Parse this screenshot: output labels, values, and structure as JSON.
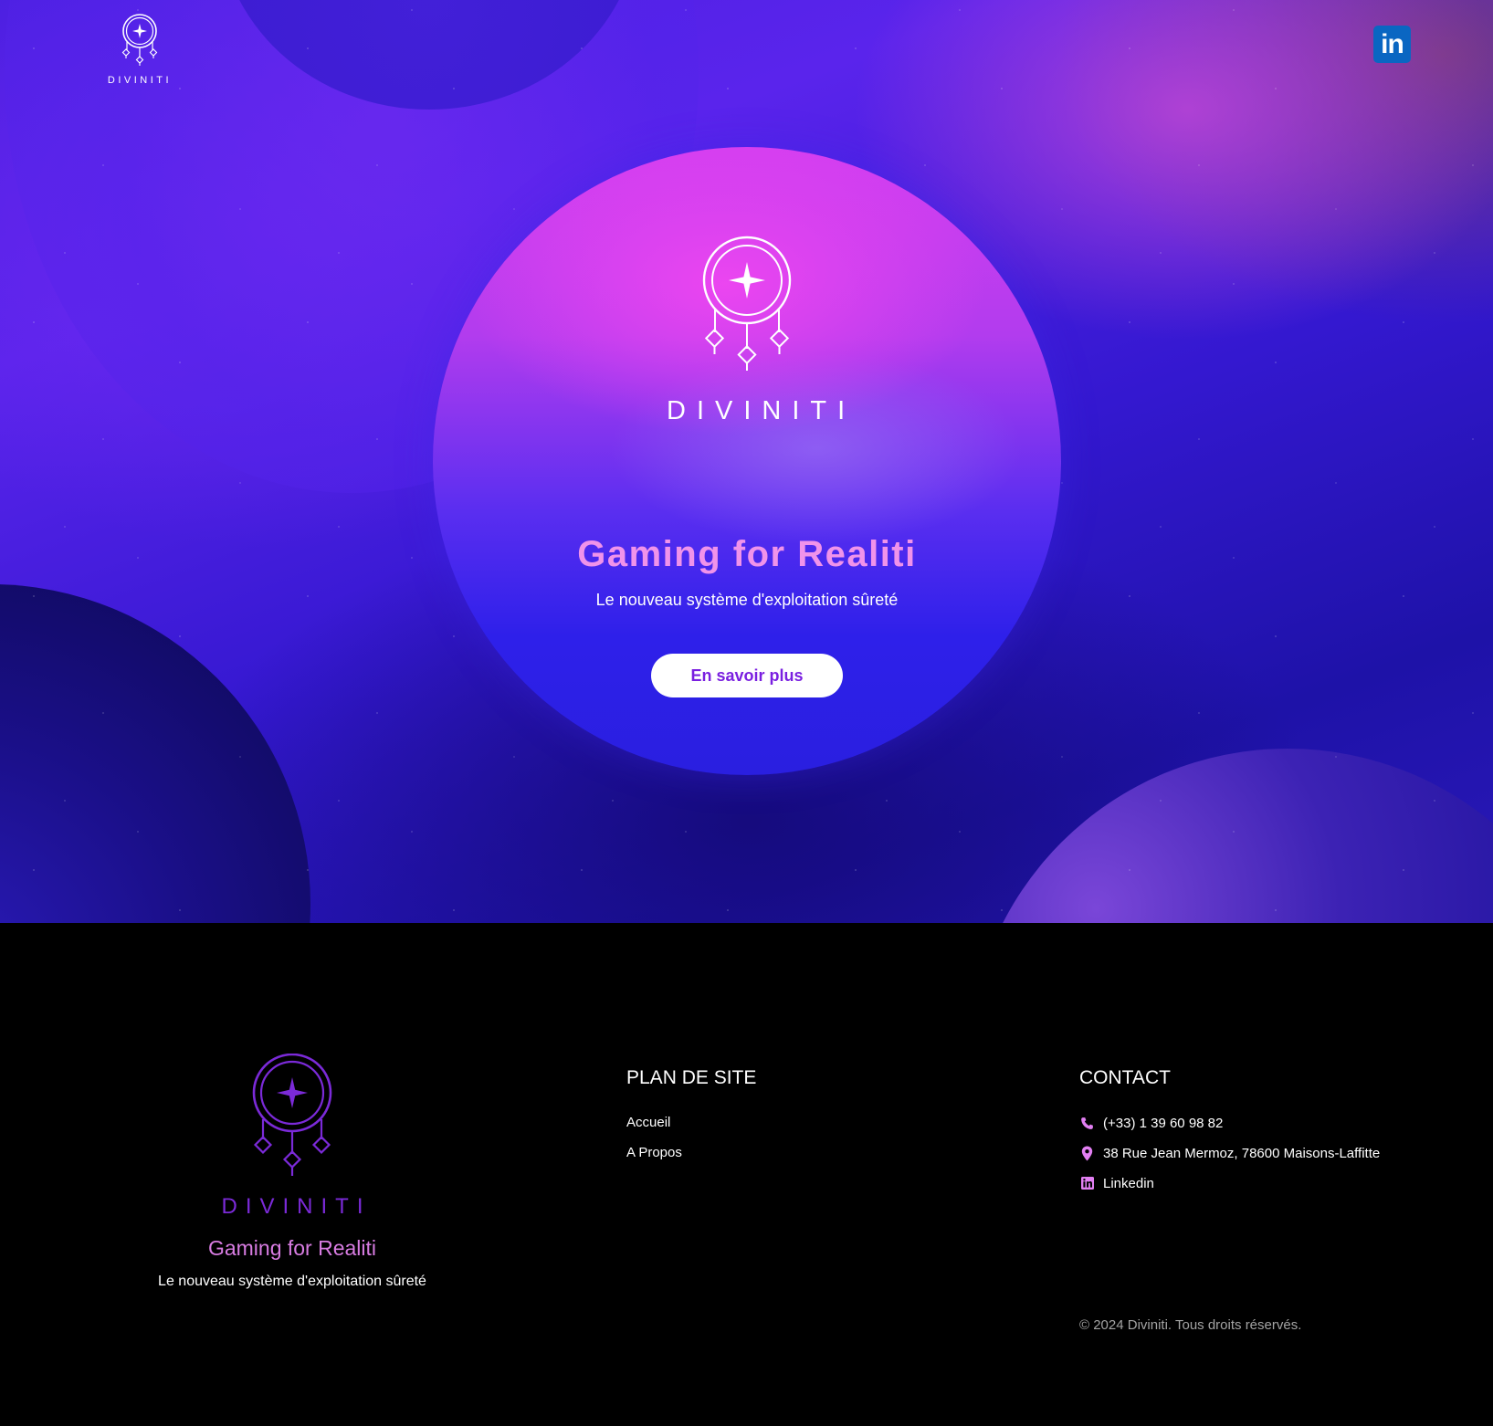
{
  "brand": {
    "name": "DIVINITI"
  },
  "colors": {
    "accent_pink": "#f093ea",
    "accent_purple": "#7b2ad8",
    "linkedin_blue": "#0a66c2",
    "button_text": "#7a1fe0"
  },
  "header": {
    "logo_icon": "dreamcatcher-star-icon",
    "linkedin_icon": "linkedin-icon",
    "linkedin_label": "in"
  },
  "hero": {
    "title": "Gaming for Realiti",
    "subtitle": "Le nouveau système d'exploitation sûreté",
    "cta_label": "En savoir plus"
  },
  "footer": {
    "brand_tagline": "Gaming for Realiti",
    "brand_subtagline": "Le nouveau système d'exploitation sûreté",
    "sitemap": {
      "title": "PLAN DE SITE",
      "links": [
        "Accueil",
        "A Propos"
      ]
    },
    "contact": {
      "title": "CONTACT",
      "phone": "(+33) 1 39 60 98 82",
      "address": "38 Rue Jean Mermoz, 78600 Maisons-Laffitte",
      "linkedin": "Linkedin",
      "icons": [
        "phone-icon",
        "location-pin-icon",
        "linkedin-icon"
      ]
    },
    "copyright": "© 2024 Diviniti. Tous droits réservés."
  }
}
